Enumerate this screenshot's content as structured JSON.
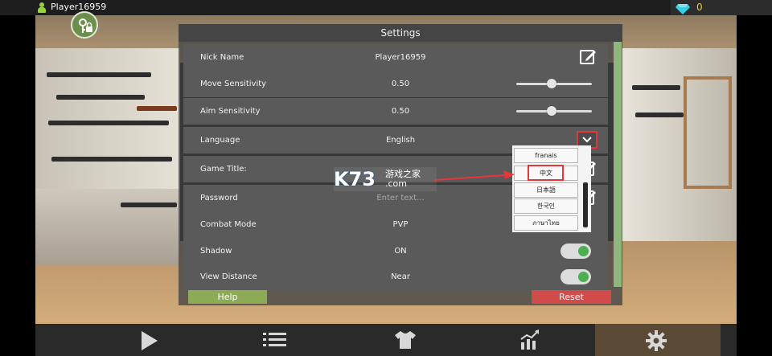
{
  "topbar": {
    "player_name": "Player16959",
    "gem_count": "0"
  },
  "settings": {
    "title": "Settings",
    "rows": [
      {
        "label": "Nick Name",
        "value": "Player16959"
      },
      {
        "label": "Move Sensitivity",
        "value": "0.50",
        "slider_fraction": 0.5
      },
      {
        "label": "Aim Sensitivity",
        "value": "0.50",
        "slider_fraction": 0.5
      },
      {
        "label": "Language",
        "value": "English"
      },
      {
        "label": "Game Title:",
        "value": ""
      },
      {
        "label": "Password",
        "placeholder": "Enter text..."
      },
      {
        "label": "Combat Mode",
        "value": "PVP"
      },
      {
        "label": "Shadow",
        "value": "ON",
        "toggle_on": true
      },
      {
        "label": "View Distance",
        "value": "Near",
        "toggle_on": true
      }
    ],
    "language_options": [
      "franais",
      "中文",
      "日本語",
      "한국인",
      "ภาษาไทย"
    ],
    "help_label": "Help",
    "reset_label": "Reset"
  },
  "watermark": {
    "main": "K73",
    "cn": "游戏之家",
    "com": ".com"
  },
  "bottom_nav": [
    "play-icon",
    "list-icon",
    "shirt-icon",
    "stats-icon",
    "gear-icon"
  ],
  "colors": {
    "help_green": "#8daa57",
    "reset_red": "#d24b4b",
    "toggle_green": "#4caf50",
    "annotation_red": "#e5363b",
    "gem_cyan": "#36d1e6"
  }
}
